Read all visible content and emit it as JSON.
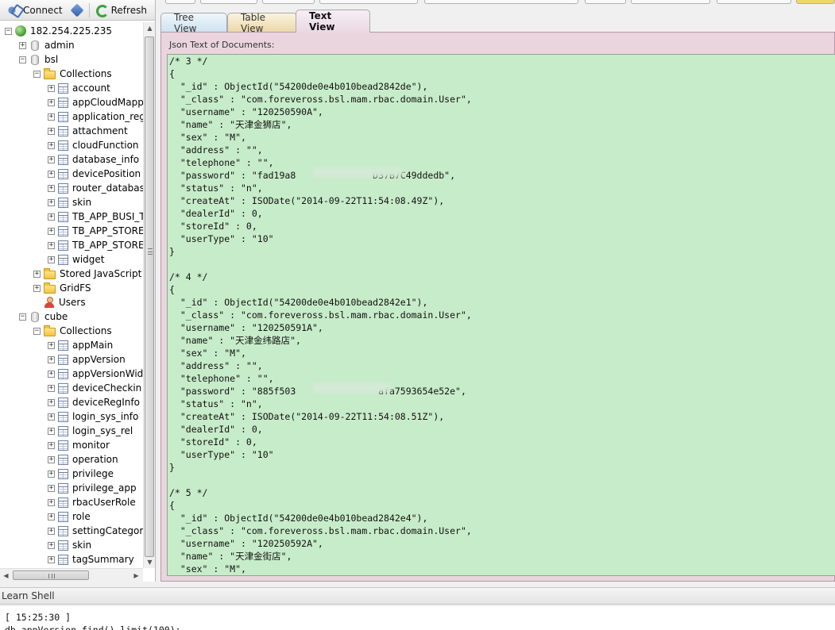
{
  "toolbar": {
    "connect_label": "Connect",
    "refresh_label": "Refresh"
  },
  "tree": [
    {
      "label": "182.254.225.235",
      "icon": "server-icon",
      "depth": 0,
      "exp": "−"
    },
    {
      "label": "admin",
      "icon": "database-icon",
      "depth": 1,
      "exp": "+"
    },
    {
      "label": "bsl",
      "icon": "database-icon",
      "depth": 1,
      "exp": "−"
    },
    {
      "label": "Collections",
      "icon": "folder-icon",
      "depth": 2,
      "exp": "−"
    },
    {
      "label": "account",
      "icon": "table-icon",
      "depth": 3,
      "exp": "+"
    },
    {
      "label": "appCloudMapp",
      "icon": "table-icon",
      "depth": 3,
      "exp": "+"
    },
    {
      "label": "application_reg",
      "icon": "table-icon",
      "depth": 3,
      "exp": "+"
    },
    {
      "label": "attachment",
      "icon": "table-icon",
      "depth": 3,
      "exp": "+"
    },
    {
      "label": "cloudFunction",
      "icon": "table-icon",
      "depth": 3,
      "exp": "+"
    },
    {
      "label": "database_info",
      "icon": "table-icon",
      "depth": 3,
      "exp": "+"
    },
    {
      "label": "devicePosition",
      "icon": "table-icon",
      "depth": 3,
      "exp": "+"
    },
    {
      "label": "router_database",
      "icon": "table-icon",
      "depth": 3,
      "exp": "+"
    },
    {
      "label": "skin",
      "icon": "table-icon",
      "depth": 3,
      "exp": "+"
    },
    {
      "label": "TB_APP_BUSI_T",
      "icon": "table-icon",
      "depth": 3,
      "exp": "+"
    },
    {
      "label": "TB_APP_STORE",
      "icon": "table-icon",
      "depth": 3,
      "exp": "+"
    },
    {
      "label": "TB_APP_STORE",
      "icon": "table-icon",
      "depth": 3,
      "exp": "+"
    },
    {
      "label": "widget",
      "icon": "table-icon",
      "depth": 3,
      "exp": "+"
    },
    {
      "label": "Stored JavaScript",
      "icon": "folder-icon",
      "depth": 2,
      "exp": "+"
    },
    {
      "label": "GridFS",
      "icon": "folder-icon",
      "depth": 2,
      "exp": "+"
    },
    {
      "label": "Users",
      "icon": "user-icon",
      "depth": 2,
      "exp": ""
    },
    {
      "label": "cube",
      "icon": "database-icon",
      "depth": 1,
      "exp": "−"
    },
    {
      "label": "Collections",
      "icon": "folder-icon",
      "depth": 2,
      "exp": "−"
    },
    {
      "label": "appMain",
      "icon": "table-icon",
      "depth": 3,
      "exp": "+"
    },
    {
      "label": "appVersion",
      "icon": "table-icon",
      "depth": 3,
      "exp": "+"
    },
    {
      "label": "appVersionWid",
      "icon": "table-icon",
      "depth": 3,
      "exp": "+"
    },
    {
      "label": "deviceCheckin",
      "icon": "table-icon",
      "depth": 3,
      "exp": "+"
    },
    {
      "label": "deviceRegInfo",
      "icon": "table-icon",
      "depth": 3,
      "exp": "+"
    },
    {
      "label": "login_sys_info",
      "icon": "table-icon",
      "depth": 3,
      "exp": "+"
    },
    {
      "label": "login_sys_rel",
      "icon": "table-icon",
      "depth": 3,
      "exp": "+"
    },
    {
      "label": "monitor",
      "icon": "table-icon",
      "depth": 3,
      "exp": "+"
    },
    {
      "label": "operation",
      "icon": "table-icon",
      "depth": 3,
      "exp": "+"
    },
    {
      "label": "privilege",
      "icon": "table-icon",
      "depth": 3,
      "exp": "+"
    },
    {
      "label": "privilege_app",
      "icon": "table-icon",
      "depth": 3,
      "exp": "+"
    },
    {
      "label": "rbacUserRole",
      "icon": "table-icon",
      "depth": 3,
      "exp": "+"
    },
    {
      "label": "role",
      "icon": "table-icon",
      "depth": 3,
      "exp": "+"
    },
    {
      "label": "settingCategory",
      "icon": "table-icon",
      "depth": 3,
      "exp": "+"
    },
    {
      "label": "skin",
      "icon": "table-icon",
      "depth": 3,
      "exp": "+"
    },
    {
      "label": "tagSummary",
      "icon": "table-icon",
      "depth": 3,
      "exp": "+"
    }
  ],
  "tabs": {
    "tree_view": "Tree View",
    "table_view": "Table View",
    "text_view": "Text View",
    "active": "Text View"
  },
  "json_panel": {
    "label": "Json Text of Documents:",
    "lines": [
      "/* 3 */",
      "{",
      "  \"_id\" : ObjectId(\"54200de0e4b010bead2842de\"),",
      "  \"_class\" : \"com.foreveross.bsl.mam.rbac.domain.User\",",
      "  \"username\" : \"120250590A\",",
      "  \"name\" : \"天津金狮店\",",
      "  \"sex\" : \"M\",",
      "  \"address\" : \"\",",
      "  \"telephone\" : \"\",",
      "  \"password\" : \"fad19a8              D37B7C49ddedb\",",
      "  \"status\" : \"n\",",
      "  \"createAt\" : ISODate(\"2014-09-22T11:54:08.49Z\"),",
      "  \"dealerId\" : 0,",
      "  \"storeId\" : 0,",
      "  \"userType\" : \"10\"",
      "}",
      "",
      "/* 4 */",
      "{",
      "  \"_id\" : ObjectId(\"54200de0e4b010bead2842e1\"),",
      "  \"_class\" : \"com.foreveross.bsl.mam.rbac.domain.User\",",
      "  \"username\" : \"120250591A\",",
      "  \"name\" : \"天津金纬路店\",",
      "  \"sex\" : \"M\",",
      "  \"address\" : \"\",",
      "  \"telephone\" : \"\",",
      "  \"password\" : \"885f503               afa7593654e52e\",",
      "  \"status\" : \"n\",",
      "  \"createAt\" : ISODate(\"2014-09-22T11:54:08.51Z\"),",
      "  \"dealerId\" : 0,",
      "  \"storeId\" : 0,",
      "  \"userType\" : \"10\"",
      "}",
      "",
      "/* 5 */",
      "{",
      "  \"_id\" : ObjectId(\"54200de0e4b010bead2842e4\"),",
      "  \"_class\" : \"com.foreveross.bsl.mam.rbac.domain.User\",",
      "  \"username\" : \"120250592A\",",
      "  \"name\" : \"天津金街店\",",
      "  \"sex\" : \"M\","
    ]
  },
  "shell": {
    "title": "Learn Shell",
    "lines": [
      "[ 15:25:30 ]",
      "db.appVersion.find().limit(100);"
    ]
  }
}
